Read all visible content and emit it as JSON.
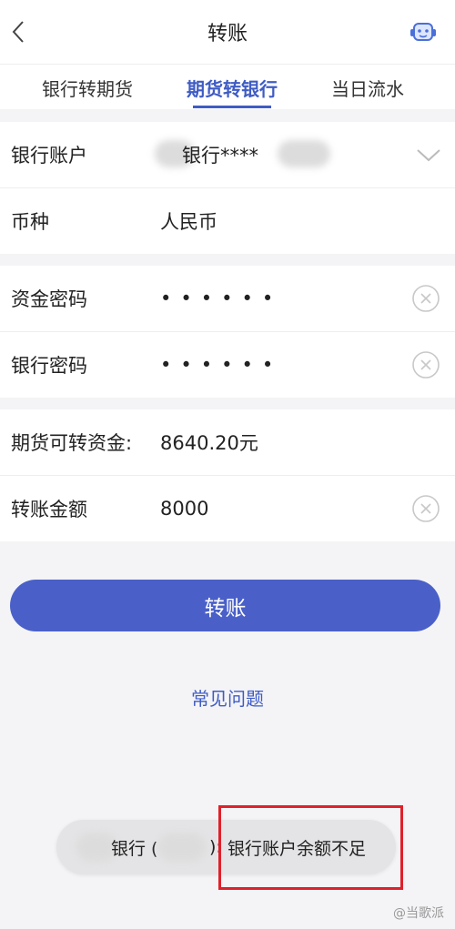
{
  "header": {
    "title": "转账"
  },
  "tabs": [
    {
      "label": "银行转期货",
      "active": false
    },
    {
      "label": "期货转银行",
      "active": true
    },
    {
      "label": "当日流水",
      "active": false
    }
  ],
  "account_section": {
    "bank_account": {
      "label": "银行账户",
      "value": "银行****"
    },
    "currency": {
      "label": "币种",
      "value": "人民币"
    }
  },
  "password_section": {
    "fund_password": {
      "label": "资金密码",
      "value": "••••••"
    },
    "bank_password": {
      "label": "银行密码",
      "value": "••••••"
    }
  },
  "amount_section": {
    "transferable": {
      "label": "期货可转资金:",
      "value": "8640.20元"
    },
    "amount": {
      "label": "转账金额",
      "value": "8000"
    }
  },
  "submit_label": "转账",
  "faq_label": "常见问题",
  "toast": {
    "prefix": "银行 (",
    "separator": "):",
    "message": "银行账户余额不足"
  },
  "watermark": "@当歌派",
  "colors": {
    "accent": "#4a60c8",
    "highlight": "#e0202a"
  },
  "icons": [
    "back-icon",
    "customer-service-icon",
    "chevron-down-icon",
    "clear-icon"
  ]
}
